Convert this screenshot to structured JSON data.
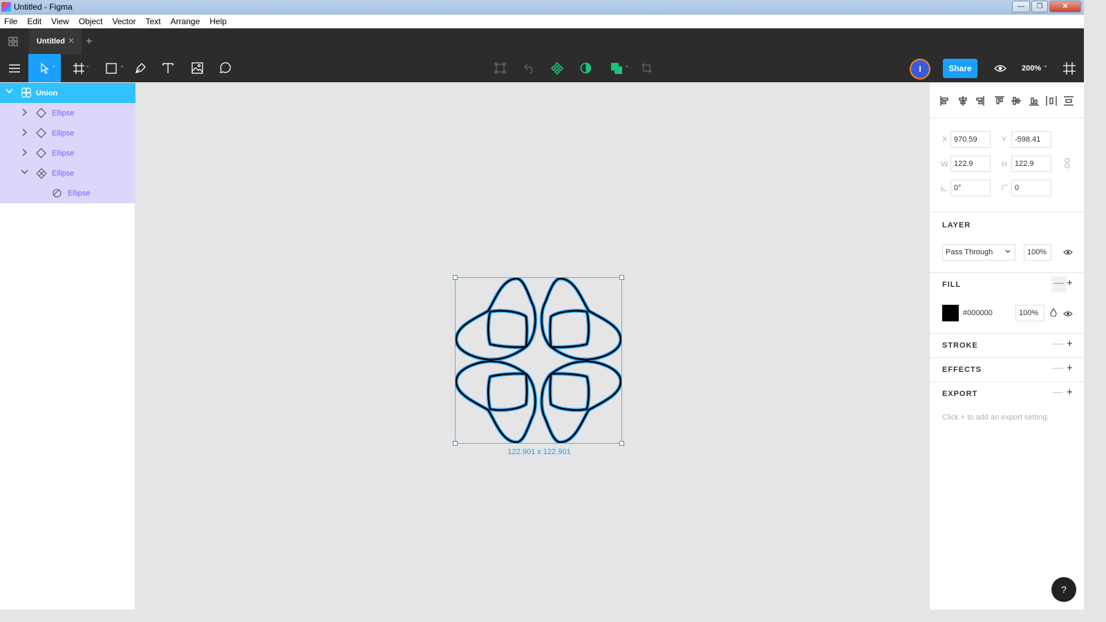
{
  "window": {
    "title": "Untitled - Figma",
    "minimize": "—",
    "restore": "❐",
    "close": "✕"
  },
  "menu": [
    "File",
    "Edit",
    "View",
    "Object",
    "Vector",
    "Text",
    "Arrange",
    "Help"
  ],
  "tabs": {
    "active_label": "Untitled",
    "close_glyph": "✕",
    "add_glyph": "+"
  },
  "toolbar": {
    "avatar_initial": "I",
    "share_label": "Share",
    "zoom_label": "200%",
    "chevron": "⌄",
    "colors": {
      "accent": "#18a0fb",
      "component": "#1bc47d"
    }
  },
  "layers": [
    {
      "label": "Union",
      "level": 0,
      "expanded": true,
      "icon": "union-icon"
    },
    {
      "label": "Ellipse",
      "level": 1,
      "expanded": false,
      "icon": "vector-diamond-icon"
    },
    {
      "label": "Ellipse",
      "level": 1,
      "expanded": false,
      "icon": "vector-diamond-icon"
    },
    {
      "label": "Ellipse",
      "level": 1,
      "expanded": false,
      "icon": "vector-diamond-icon"
    },
    {
      "label": "Ellipse",
      "level": 1,
      "expanded": true,
      "icon": "component-icon"
    },
    {
      "label": "Ellipse",
      "level": 2,
      "expanded": false,
      "icon": "ellipse-icon"
    }
  ],
  "canvas": {
    "selection_size": "122.901 x 122.901"
  },
  "properties": {
    "x": {
      "label": "X",
      "value": "970.59"
    },
    "y": {
      "label": "Y",
      "value": "-598.41"
    },
    "w": {
      "label": "W",
      "value": "122.9"
    },
    "h": {
      "label": "H",
      "value": "122.9"
    },
    "rotation": {
      "value": "0°"
    },
    "radius": {
      "value": "0"
    },
    "layer": {
      "title": "LAYER",
      "blend": "Pass Through",
      "opacity": "100%"
    },
    "fill": {
      "title": "FILL",
      "hex": "#000000",
      "opacity": "100%",
      "color": "#000000"
    },
    "stroke": {
      "title": "STROKE"
    },
    "effects": {
      "title": "EFFECTS"
    },
    "export": {
      "title": "EXPORT",
      "hint": "Click + to add an export setting."
    },
    "plus": "+",
    "minus": "—"
  },
  "help": {
    "label": "?"
  }
}
